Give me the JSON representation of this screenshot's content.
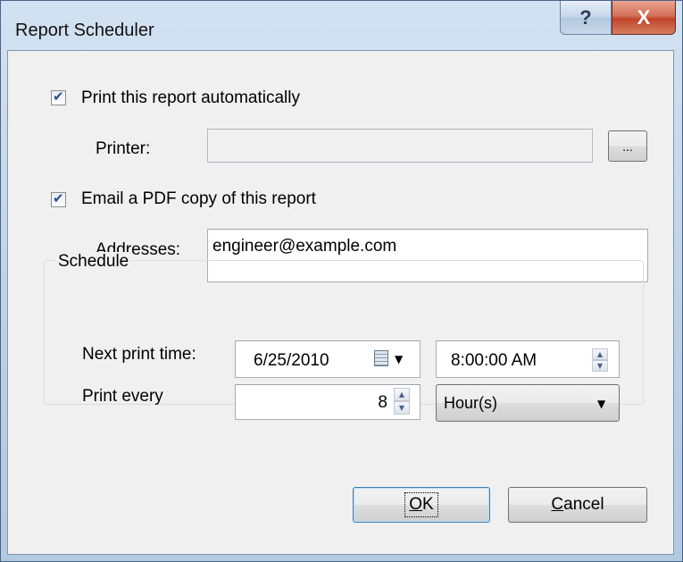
{
  "window": {
    "title": "Report Scheduler",
    "help_glyph": "?",
    "close_glyph": "X"
  },
  "print_section": {
    "checkbox_label": "Print this report automatically",
    "checked": true,
    "printer_label": "Printer:",
    "printer_value": "",
    "browse_label": "..."
  },
  "email_section": {
    "checkbox_label": "Email a PDF copy of this report",
    "checked": true,
    "addresses_label": "Addresses:",
    "addresses_value": "engineer@example.com"
  },
  "schedule": {
    "group_title": "Schedule",
    "next_print_label": "Next print time:",
    "date_value": "6/25/2010",
    "time_value": "8:00:00 AM",
    "print_every_label": "Print every",
    "interval_value": "8",
    "unit_value": "Hour(s)"
  },
  "buttons": {
    "ok_label": "OK",
    "ok_mnemonic": "O",
    "ok_rest": "K",
    "cancel_mnemonic": "C",
    "cancel_rest": "ancel"
  },
  "icons": {
    "calendar": "calendar-icon",
    "spin_up": "up-arrow-icon",
    "spin_down": "down-arrow-icon",
    "dropdown": "chevron-down-icon"
  }
}
